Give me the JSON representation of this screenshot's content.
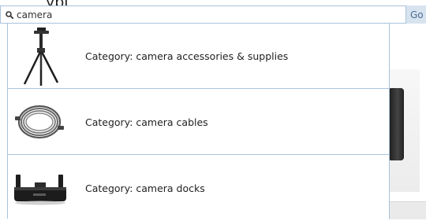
{
  "background": {
    "heading_fragment": "ypi"
  },
  "search": {
    "value": "camera",
    "go_label": "Go"
  },
  "suggestions": [
    {
      "label": "Category: camera accessories & supplies",
      "icon": "tripod-icon"
    },
    {
      "label": "Category: camera cables",
      "icon": "cable-coil-icon"
    },
    {
      "label": "Category: camera docks",
      "icon": "camera-dock-icon"
    }
  ],
  "colors": {
    "border": "#a9c3dc",
    "go_button_bg": "#d7e3ef",
    "go_button_text": "#4a6d91"
  }
}
